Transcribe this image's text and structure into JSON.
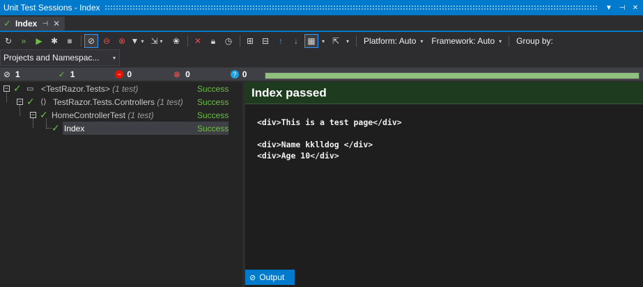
{
  "window": {
    "title": "Unit Test Sessions - Index"
  },
  "tab": {
    "label": "Index",
    "pin_glyph": "⊣",
    "close_glyph": "✕"
  },
  "toolbar": {
    "platform_label": "Platform: Auto",
    "framework_label": "Framework: Auto",
    "group_by_label": "Group by:"
  },
  "group_select": {
    "value": "Projects and Namespac..."
  },
  "summary": {
    "total": "1",
    "passed": "1",
    "failed": "0",
    "ignored": "0",
    "unknown": "0",
    "progress_fraction": 1.0,
    "progress_color": "#90c080"
  },
  "tree": {
    "nodes": [
      {
        "name": "<TestRazor.Tests>",
        "count": "(1 test)",
        "status": "Success"
      },
      {
        "name": "TestRazor.Tests.Controllers",
        "count": "(1 test)",
        "status": "Success"
      },
      {
        "name": "HomeControllerTest",
        "count": "(1 test)",
        "status": "Success"
      },
      {
        "name": "Index",
        "count": "",
        "status": "Success"
      }
    ]
  },
  "detail": {
    "header": "Index passed",
    "lines": [
      "<div>This is a test page</div>",
      "<div>Name kklldog </div>",
      "<div>Age 10</div>"
    ]
  },
  "output_tab": {
    "label": "Output"
  },
  "colors": {
    "accent": "#007acc",
    "success": "#6cbf46",
    "fail": "#e51400",
    "passed_header": "#1f3b1f"
  }
}
